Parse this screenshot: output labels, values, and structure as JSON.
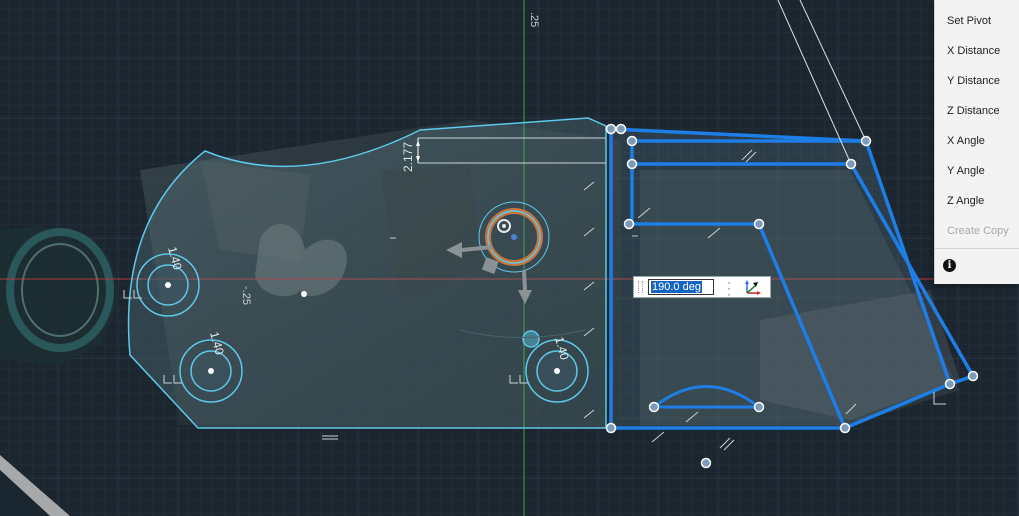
{
  "viewport": {
    "dimension_2177": "2.177",
    "dimension_top_right": ".25",
    "dimension_center": "-.25",
    "hole_dim_1": "1.40",
    "hole_dim_2": "1.40",
    "hole_dim_3": "1.40"
  },
  "angle_input": {
    "value": "190.0 deg"
  },
  "context_menu": {
    "items": [
      {
        "label": "Set Pivot",
        "enabled": true
      },
      {
        "label": "X Distance",
        "enabled": true
      },
      {
        "label": "Y Distance",
        "enabled": true
      },
      {
        "label": "Z Distance",
        "enabled": true
      },
      {
        "label": "X Angle",
        "enabled": true
      },
      {
        "label": "Y Angle",
        "enabled": true
      },
      {
        "label": "Z Angle",
        "enabled": true
      },
      {
        "label": "Create Copy",
        "enabled": false
      }
    ],
    "info_icon": "info-icon"
  },
  "colors": {
    "background": "#1b2630",
    "grid": "#2b3a45",
    "sketch_blue": "#1e7ee8",
    "profile_cyan": "#5ec8ea",
    "x_axis": "#b23a3a",
    "y_axis": "#3aa64a"
  }
}
